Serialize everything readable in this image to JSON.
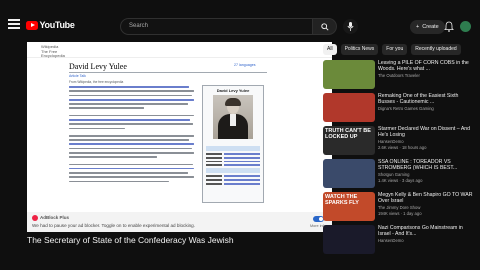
{
  "header": {
    "logo_text": "YouTube",
    "search_placeholder": "Search",
    "create_label": "Create"
  },
  "wiki": {
    "site": "Wikipedia The Free Encyclopedia",
    "title": "David Levy Yulee",
    "languages": "27 languages",
    "tabs": "Article  Talk",
    "from": "From Wikipedia, the free encyclopedia",
    "infobox_title": "David Levy Yulee"
  },
  "adblock": {
    "brand": "AdBlock Plus",
    "message": "We had to pause your ad blocker. Toggle on to enable experimental ad blocking.",
    "more": "More info"
  },
  "video": {
    "title": "The Secretary of State of the Confederacy Was Jewish"
  },
  "chips": [
    {
      "label": "All",
      "active": true
    },
    {
      "label": "Politics News",
      "active": false
    },
    {
      "label": "For you",
      "active": false
    },
    {
      "label": "Recently uploaded",
      "active": false
    }
  ],
  "recommendations": [
    {
      "title": "Leaving a PILE OF CORN COBS in the Woods. Here's what ...",
      "channel": "The Outdoors Traveler",
      "meta": "",
      "thumb_color": "#6b8a3a",
      "thumb_text": ""
    },
    {
      "title": "Remaking One of the Easiest Sixth Busses - Cautionemic ...",
      "channel": "Digna's Retro Games Gaming",
      "meta": "",
      "thumb_color": "#b1382b",
      "thumb_text": ""
    },
    {
      "title": "Starmer Declared War on Dissent – And He's Losing",
      "channel": "HansenDemo",
      "meta": "2.6K views · 18 hours ago",
      "thumb_color": "#2a2a2a",
      "thumb_text": "TRUTH CAN'T BE LOCKED UP"
    },
    {
      "title": "SSA ONLINE : TOREADOR VS STROMBERG (WHICH IS BEST...",
      "channel": "Shotgun Gaming",
      "meta": "1.4K views · 3 days ago",
      "thumb_color": "#3a4a6a",
      "thumb_text": ""
    },
    {
      "title": "Megyn Kelly & Ben Shapiro GO TO WAR Over Israel",
      "channel": "The Jimmy Dore Show",
      "meta": "194K views · 1 day ago",
      "thumb_color": "#c24a2a",
      "thumb_text": "WATCH THE SPARKS FLY"
    },
    {
      "title": "Nazi Comparisons Go Mainstream in Israel - And It's...",
      "channel": "HansenDemo",
      "meta": "",
      "thumb_color": "#1a1a2a",
      "thumb_text": ""
    }
  ]
}
